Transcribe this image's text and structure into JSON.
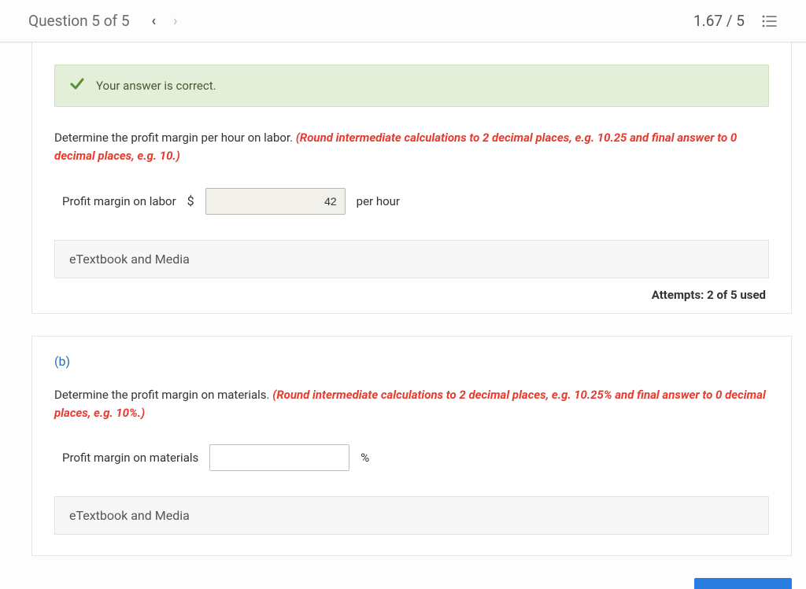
{
  "header": {
    "question_label": "Question 5 of 5",
    "score": "1.67 / 5"
  },
  "part_a": {
    "alert": "Your answer is correct.",
    "prompt_plain": "Determine the profit margin per hour on labor. ",
    "prompt_hint": "(Round intermediate calculations to 2 decimal places, e.g. 10.25 and final answer to 0 decimal places, e.g. 10.)",
    "field_label": "Profit margin on labor",
    "currency": "$",
    "value": "42",
    "unit": "per hour",
    "etextbook": "eTextbook and Media",
    "attempts": "Attempts: 2 of 5 used"
  },
  "part_b": {
    "label": "(b)",
    "prompt_plain": "Determine the profit margin on materials. ",
    "prompt_hint": "(Round intermediate calculations to 2 decimal places, e.g. 10.25% and final answer to 0 decimal places, e.g. 10%.)",
    "field_label": "Profit margin on materials",
    "value": "",
    "unit": "%",
    "etextbook": "eTextbook and Media"
  }
}
